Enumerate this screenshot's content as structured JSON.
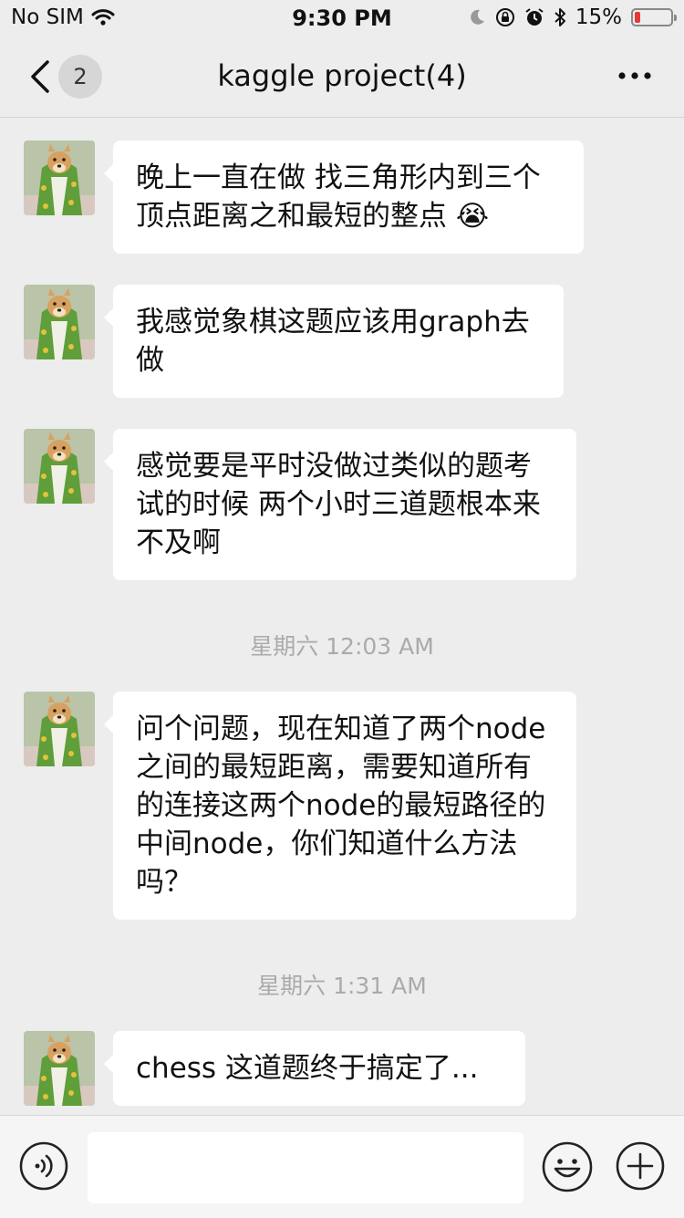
{
  "status_bar": {
    "carrier": "No SIM",
    "time": "9:30 PM",
    "battery": "15%",
    "battery_level": 0.15,
    "battery_color": "#e53935"
  },
  "nav": {
    "back_count": "2",
    "title": "kaggle project(4)"
  },
  "messages": [
    {
      "text": "晚上一直在做 找三角形内到三个顶点距离之和最短的整点 😭"
    },
    {
      "text": "我感觉象棋这题应该用graph去做"
    },
    {
      "text": "感觉要是平时没做过类似的题考试的时候 两个小时三道题根本来不及啊"
    },
    {
      "text": "问个问题，现在知道了两个node之间的最短距离，需要知道所有的连接这两个node的最短路径的中间node，你们知道什么方法吗？"
    },
    {
      "text": "chess 这道题终于搞定了..."
    }
  ],
  "timestamps": [
    {
      "text": "星期六 12:03 AM"
    },
    {
      "text": "星期六 1:31 AM"
    }
  ],
  "input_bar": {
    "value": "",
    "icons": [
      "voice-icon",
      "emoji-icon",
      "plus-icon"
    ]
  },
  "colors": {
    "background": "#ededed",
    "bubble": "#ffffff",
    "timestamp": "#aaaaaa"
  }
}
